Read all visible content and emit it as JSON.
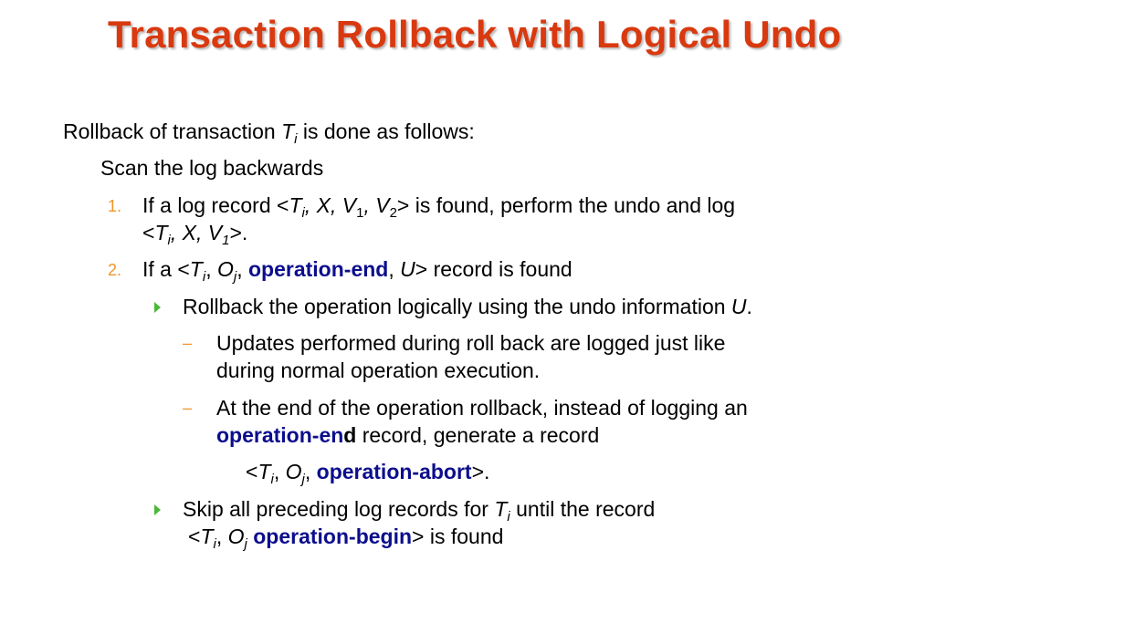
{
  "slide": {
    "title": "Transaction Rollback with Logical Undo"
  },
  "content": {
    "intro_pre": "Rollback of transaction ",
    "intro_T": "T",
    "intro_sub": "i",
    "intro_post": " is done as follows:",
    "scan": "Scan the log backwards",
    "item1": {
      "number": "1.",
      "line1_pre": "If a log record <",
      "line1_T": "T",
      "line1_Tsub": "i",
      "line1_mid1": ", X, V",
      "line1_V1sub": "1",
      "line1_mid2": ", V",
      "line1_V2sub": "2",
      "line1_post": "> is found, perform the undo and log",
      "line2_pre": "<",
      "line2_T": "T",
      "line2_Tsub": "i",
      "line2_mid": ", X, V",
      "line2_Vsub": "1",
      "line2_post": ">."
    },
    "item2": {
      "number": "2.",
      "pre": "If a <",
      "T": "T",
      "Tsub": "i",
      "comma1": ", ",
      "O": "O",
      "Osub": "j",
      "comma2": ",  ",
      "keyword": "operation-end",
      "comma3": ", ",
      "U": "U",
      "post": "> record is found"
    },
    "bullet1": {
      "pre": "Rollback the operation logically using  the undo information ",
      "U": "U",
      "post": "."
    },
    "dash1": {
      "symbol": "–",
      "line1": "Updates performed during roll back are logged just like",
      "line2": "during normal operation execution."
    },
    "dash2": {
      "symbol": "–",
      "line1": "At the end of the operation rollback, instead of logging an",
      "kw_part": "operation-en",
      "bold_part": "d",
      "line2_post": " record, generate a record"
    },
    "abort_record": {
      "pre": "<",
      "T": "T",
      "Tsub": "i",
      "comma1": ", ",
      "O": "O",
      "Osub": "j",
      "comma2": ", ",
      "keyword": "operation-abort",
      "post": ">."
    },
    "bullet2": {
      "pre": "Skip all preceding log records for ",
      "T": "T",
      "Tsub": "i",
      "post": "  until the record",
      "line2_pre": "<",
      "line2_T": "T",
      "line2_Tsub": "i",
      "line2_comma": ", ",
      "line2_O": "O",
      "line2_Osub": "j",
      "line2_space": " ",
      "line2_keyword": "operation-begin",
      "line2_post": ">  is found"
    }
  },
  "colors": {
    "title": "#d9390f",
    "keyword": "#0c0e8c",
    "number": "#f29527",
    "bullet": "#4bb839"
  }
}
